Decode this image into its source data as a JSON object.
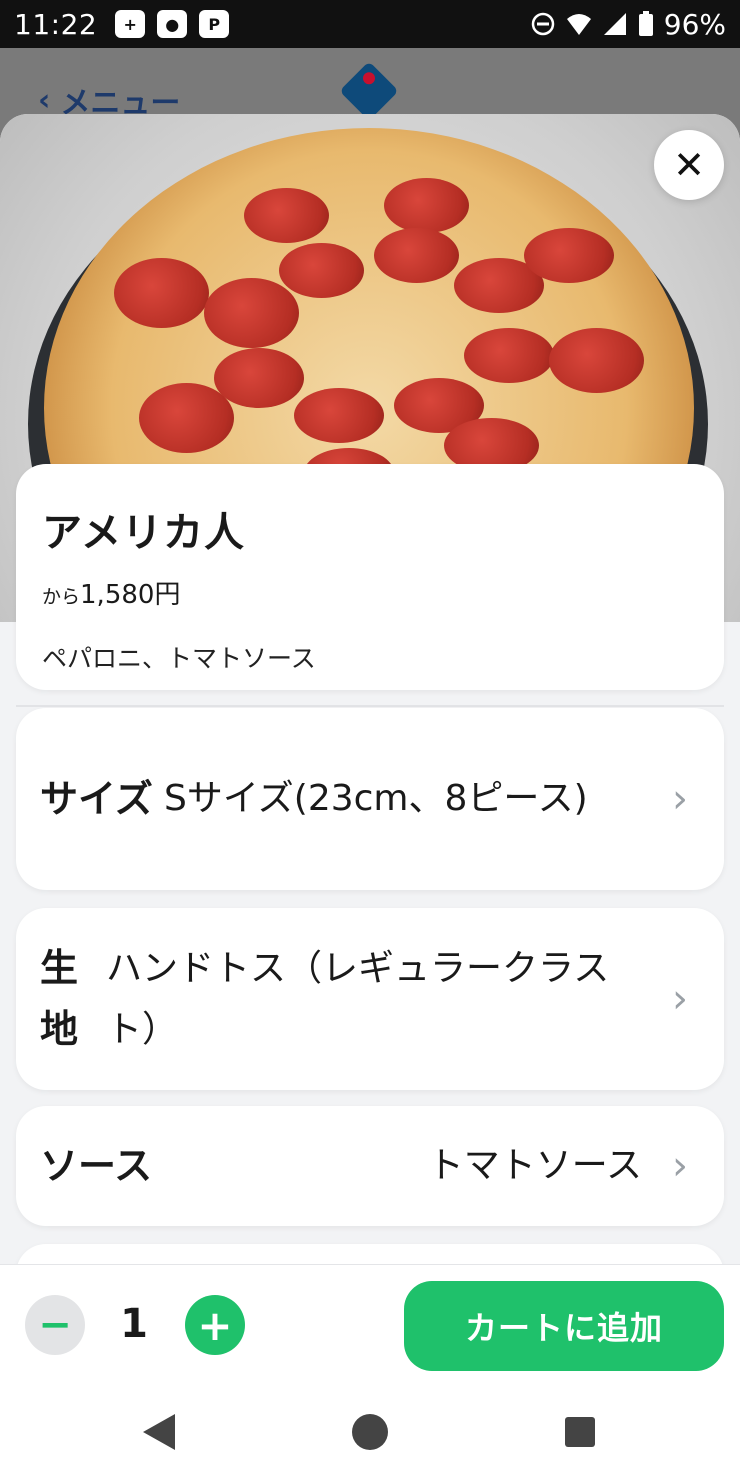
{
  "status_bar": {
    "time": "11:22",
    "battery": "96%",
    "icons": [
      "add-notification-icon",
      "app-notification-icon",
      "paypay-icon",
      "dnd-icon",
      "wifi-icon",
      "signal-icon",
      "battery-icon"
    ]
  },
  "underlying_header": {
    "back_label": "メニュー",
    "logo": "dominos-logo-icon"
  },
  "product": {
    "title": "アメリカ人",
    "price_prefix": "から",
    "price": "1,580円",
    "description": "ペパロニ、トマトソース"
  },
  "options": [
    {
      "label": "サイズ",
      "value": "Sサイズ(23cm、8ピース)"
    },
    {
      "label": "生地",
      "value": "ハンドトス（レギュラークラスト）"
    },
    {
      "label": "ソース",
      "value": "トマトソース"
    }
  ],
  "action_bar": {
    "quantity": "1",
    "minus_symbol": "−",
    "plus_symbol": "+",
    "add_to_cart": "カートに追加"
  },
  "colors": {
    "accent_green": "#1fc16b",
    "brand_blue": "#0e4a7a"
  }
}
